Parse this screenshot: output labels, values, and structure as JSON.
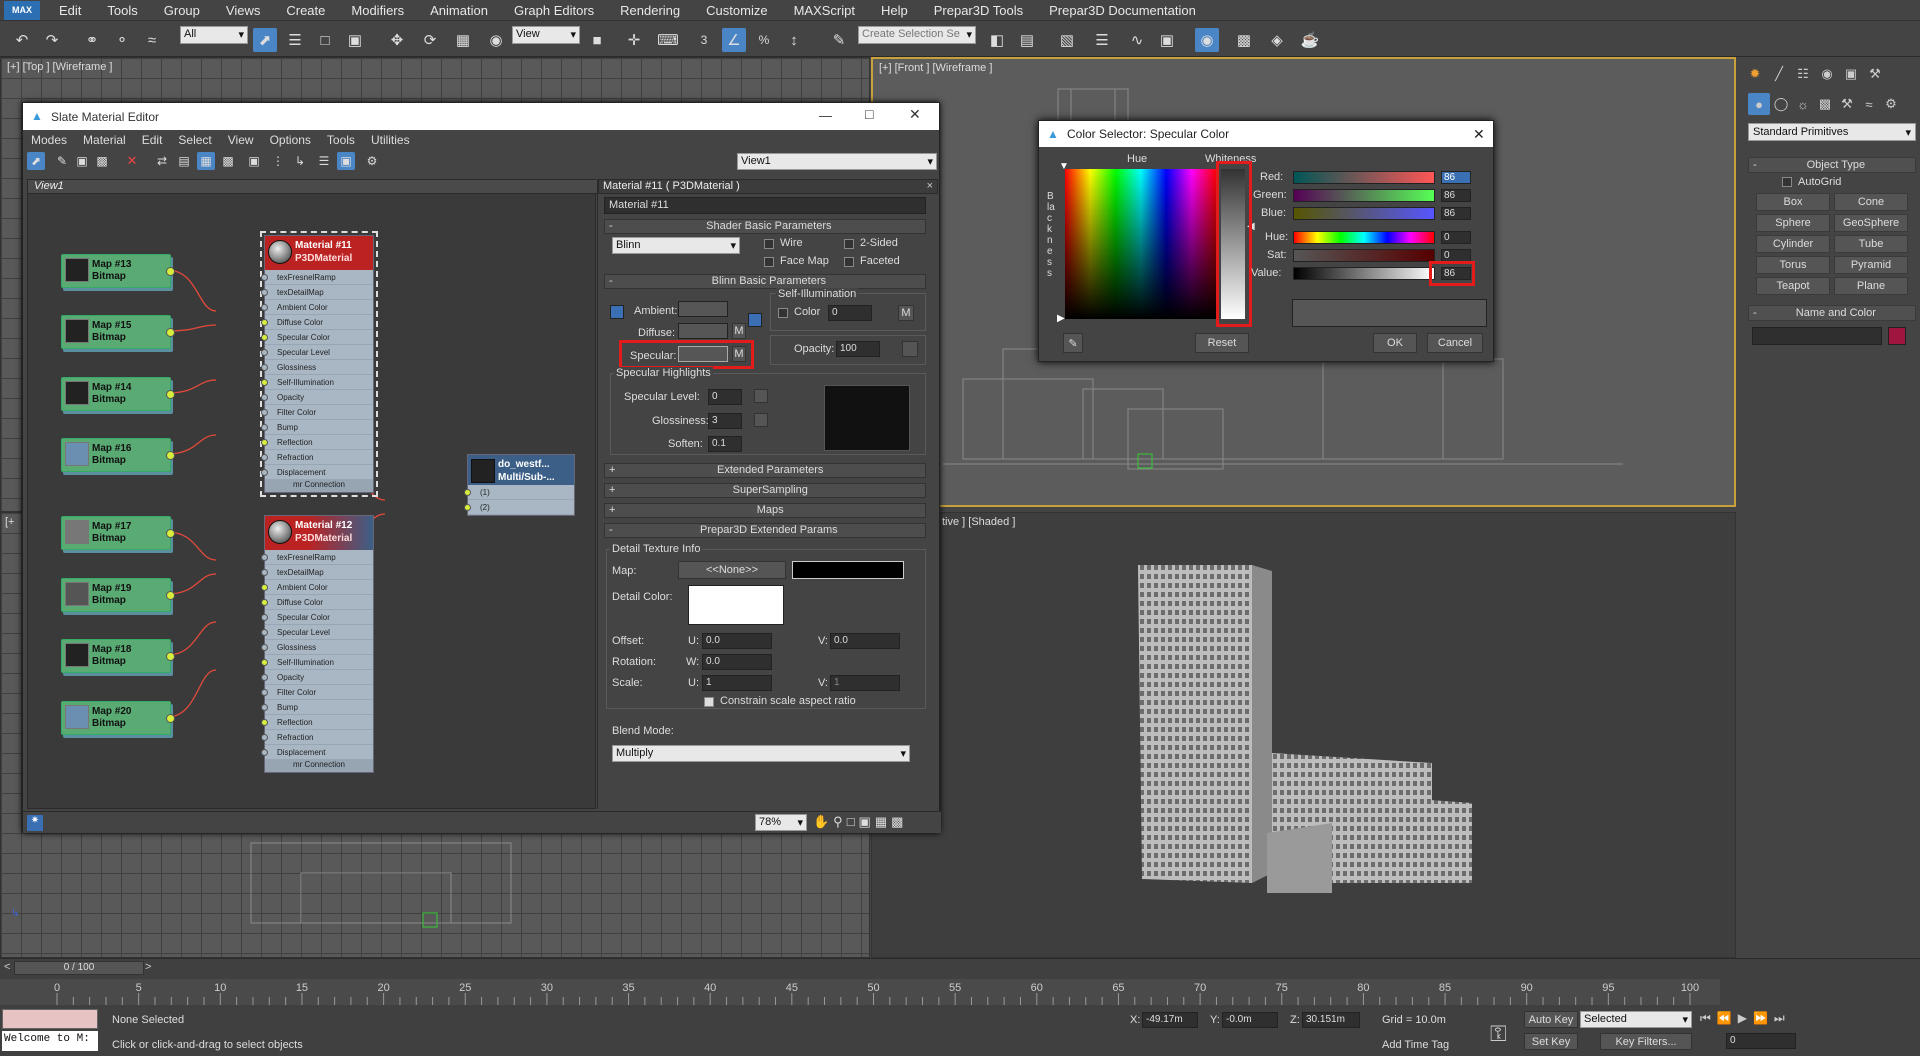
{
  "menubar": {
    "logo": "MAX",
    "items": [
      "Edit",
      "Tools",
      "Group",
      "Views",
      "Create",
      "Modifiers",
      "Animation",
      "Graph Editors",
      "Rendering",
      "Customize",
      "MAXScript",
      "Help",
      "Prepar3D Tools",
      "Prepar3D Documentation"
    ]
  },
  "toolbar": {
    "selection_filter": "All",
    "ref_coord": "View",
    "selection_set_placeholder": "Create Selection Se"
  },
  "viewports": {
    "top_label": "[+] [Top ] [Wireframe ]",
    "front_label": "[+] [Front ] [Wireframe ]",
    "left_label": "[+",
    "persp_label": "tive ] [Shaded ]"
  },
  "slate": {
    "title": "Slate Material Editor",
    "menu": [
      "Modes",
      "Material",
      "Edit",
      "Select",
      "View",
      "Options",
      "Tools",
      "Utilities"
    ],
    "view_dropdown": "View1",
    "view_tab": "View1",
    "zoom": "78%",
    "maps_top": [
      {
        "name": "Map #13",
        "type": "Bitmap"
      },
      {
        "name": "Map #15",
        "type": "Bitmap"
      },
      {
        "name": "Map #14",
        "type": "Bitmap"
      },
      {
        "name": "Map #16",
        "type": "Bitmap"
      }
    ],
    "maps_bottom": [
      {
        "name": "Map #17",
        "type": "Bitmap"
      },
      {
        "name": "Map #19",
        "type": "Bitmap"
      },
      {
        "name": "Map #18",
        "type": "Bitmap"
      },
      {
        "name": "Map #20",
        "type": "Bitmap"
      }
    ],
    "mat11": {
      "name": "Material #11",
      "type": "P3DMaterial"
    },
    "mat12": {
      "name": "Material #12",
      "type": "P3DMaterial"
    },
    "slots": [
      "texFresnelRamp",
      "texDetailMap",
      "Ambient Color",
      "Diffuse Color",
      "Specular Color",
      "Specular Level",
      "Glossiness",
      "Self-Illumination",
      "Opacity",
      "Filter Color",
      "Bump",
      "Reflection",
      "Refraction",
      "Displacement"
    ],
    "mr_connection": "mr Connection",
    "multi": {
      "name": "do_westf...",
      "type": "Multi/Sub-...",
      "slot1": "(1)",
      "slot2": "(2)"
    }
  },
  "params": {
    "header": "Material #11  ( P3DMaterial )",
    "name_field": "Material #11",
    "shader_basic": "Shader Basic Parameters",
    "shader": "Blinn",
    "wire": "Wire",
    "two_sided": "2-Sided",
    "face_map": "Face Map",
    "faceted": "Faceted",
    "blinn_basic": "Blinn Basic Parameters",
    "self_illum": "Self-Illumination",
    "ambient": "Ambient:",
    "diffuse": "Diffuse:",
    "specular": "Specular:",
    "color": "Color",
    "color_val": "0",
    "opacity": "Opacity:",
    "opacity_val": "100",
    "m": "M",
    "spec_highlights": "Specular Highlights",
    "spec_level": "Specular Level:",
    "spec_level_val": "0",
    "glossiness": "Glossiness:",
    "glossiness_val": "3",
    "soften": "Soften:",
    "soften_val": "0.1",
    "extended": "Extended Parameters",
    "supersampling": "SuperSampling",
    "maps": "Maps",
    "p3d_ext": "Prepar3D Extended Params",
    "detail_info": "Detail Texture Info",
    "map": "Map:",
    "map_none": "<<None>>",
    "detail_color": "Detail Color:",
    "offset": "Offset:",
    "rotation": "Rotation:",
    "scale": "Scale:",
    "u": "U:",
    "v": "V:",
    "w": "W:",
    "offset_u": "0.0",
    "offset_v": "0.0",
    "rotation_w": "0.0",
    "scale_u": "1",
    "scale_v": "1",
    "constrain": "Constrain scale aspect ratio",
    "blend_mode": "Blend Mode:",
    "blend_val": "Multiply",
    "plus": "+",
    "minus": "-"
  },
  "colorsel": {
    "title": "Color Selector: Specular Color",
    "hue_label": "Hue",
    "whiteness": "Whiteness",
    "blackness": "Blackness",
    "red": "Red:",
    "green": "Green:",
    "blue": "Blue:",
    "hue": "Hue:",
    "sat": "Sat:",
    "value": "Value:",
    "red_val": "86",
    "green_val": "86",
    "blue_val": "86",
    "hue_val": "0",
    "sat_val": "0",
    "value_val": "86",
    "reset": "Reset",
    "ok": "OK",
    "cancel": "Cancel",
    "swatch_color": "#565656"
  },
  "cmdpanel": {
    "category": "Standard Primitives",
    "object_type": "Object Type",
    "autogrid": "AutoGrid",
    "buttons": [
      "Box",
      "Cone",
      "Sphere",
      "GeoSphere",
      "Cylinder",
      "Tube",
      "Torus",
      "Pyramid",
      "Teapot",
      "Plane"
    ],
    "name_color": "Name and Color",
    "minus": "-"
  },
  "timeline": {
    "frame": "0 / 100",
    "ticks": [
      "0",
      "5",
      "10",
      "15",
      "20",
      "25",
      "30",
      "35",
      "40",
      "45",
      "50",
      "55",
      "60",
      "65",
      "70",
      "75",
      "80",
      "85",
      "90",
      "95",
      "100"
    ],
    "status1": "None Selected",
    "status2": "Click or click-and-drag to select objects",
    "welcome": "Welcome to M:",
    "x_label": "X:",
    "x_val": "-49.17m",
    "y_label": "Y:",
    "y_val": "-0.0m",
    "z_label": "Z:",
    "z_val": "30.151m",
    "grid": "Grid = 10.0m",
    "auto_key": "Auto Key",
    "selected": "Selected",
    "set_key": "Set Key",
    "key_filters": "Key Filters...",
    "add_time_tag": "Add Time Tag",
    "frame_val": "0"
  }
}
